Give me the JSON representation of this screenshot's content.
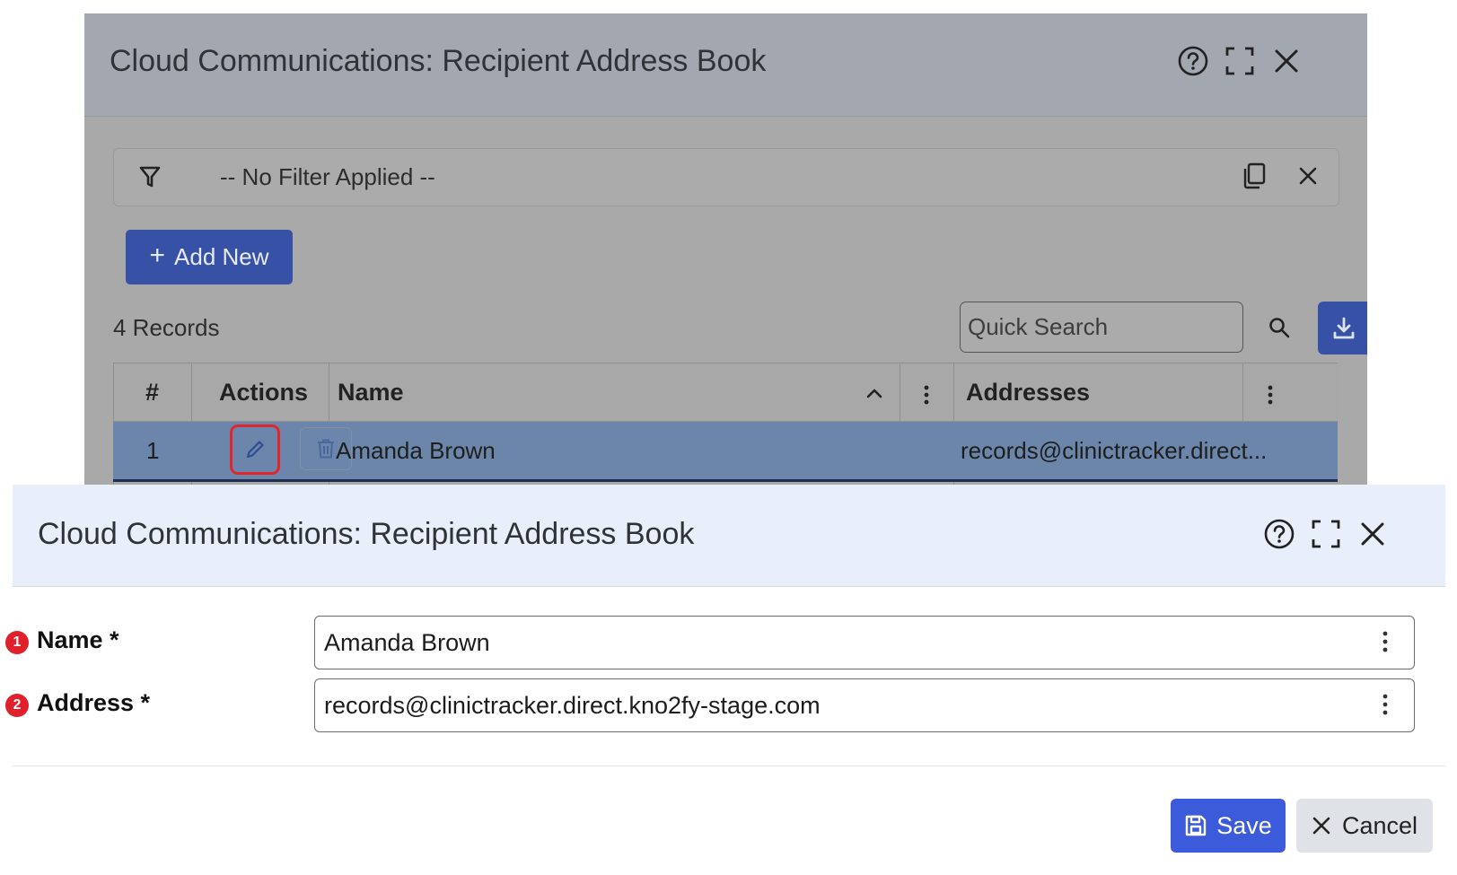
{
  "background_window": {
    "title": "Cloud Communications: Recipient Address Book",
    "filter": {
      "text": "-- No Filter Applied --"
    },
    "add_new_label": "Add New",
    "add_new_prefix": "+",
    "record_count": "4 Records",
    "search": {
      "placeholder": "Quick Search"
    },
    "grid": {
      "columns": [
        "#",
        "Actions",
        "Name",
        "Addresses"
      ],
      "rows": [
        {
          "index": "1",
          "name": "Amanda Brown",
          "addresses": "records@clinictracker.direct..."
        }
      ]
    }
  },
  "dialog": {
    "title": "Cloud Communications: Recipient Address Book",
    "fields": [
      {
        "step": "1",
        "label": "Name *",
        "value": "Amanda Brown"
      },
      {
        "step": "2",
        "label": "Address *",
        "value": "records@clinictracker.direct.kno2fy-stage.com"
      }
    ],
    "save_label": "Save",
    "cancel_label": "Cancel"
  },
  "colors": {
    "primary": "#3751a6",
    "save": "#3b5bdb",
    "highlight_red": "#e0262b",
    "selected_row": "#6b86aa",
    "dialog_header": "#e9effa"
  }
}
